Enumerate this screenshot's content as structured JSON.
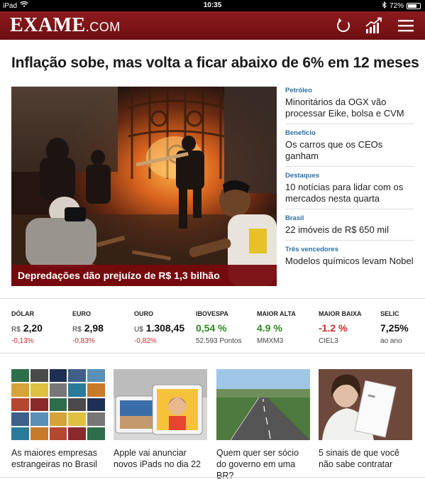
{
  "statusbar": {
    "device": "iPad",
    "time": "10:35",
    "battery": "72%",
    "battery_level": 0.72
  },
  "header": {
    "logo": "EXAME",
    "logo_suffix": ".COM",
    "refresh_icon": "refresh-icon",
    "chart_icon": "chart-icon",
    "menu_icon": "menu-icon",
    "brand_color": "#7a1216"
  },
  "headline": "Inflação sobe, mas volta a ficar abaixo de 6% em 12 meses",
  "hero": {
    "caption": "Depredações dão prejuízo de R$ 1,3 bilhão"
  },
  "side_news": [
    {
      "kicker": "Petróleo",
      "title": "Minoritários da OGX vão processar Eike, bolsa e CVM"
    },
    {
      "kicker": "Benefício",
      "title": "Os carros que os CEOs ganham"
    },
    {
      "kicker": "Destaques",
      "title": "10 notícias para lidar com os mercados nesta quarta"
    },
    {
      "kicker": "Brasil",
      "title": "22 imóveis de R$ 650 mil"
    },
    {
      "kicker": "Três vencedores",
      "title": "Modelos químicos levam Nobel"
    }
  ],
  "market": [
    {
      "label": "DÓLAR",
      "currency": "R$",
      "value": "2,20",
      "sub": "-0,13%"
    },
    {
      "label": "EURO",
      "currency": "R$",
      "value": "2,98",
      "sub": "-0,83%"
    },
    {
      "label": "OURO",
      "currency": "U$",
      "value": "1.308,45",
      "sub": "-0,82%"
    },
    {
      "label": "IBOVESPA",
      "currency": "",
      "value": "0,54 %",
      "sub": "52.593 Pontos"
    },
    {
      "label": "MAIOR ALTA",
      "currency": "",
      "value": "4.9 %",
      "sub": "MMXM3"
    },
    {
      "label": "MAIOR BAIXA",
      "currency": "",
      "value": "-1.2 %",
      "sub": "CIEL3"
    },
    {
      "label": "SELIC",
      "currency": "",
      "value": "7,25%",
      "sub": "ao ano"
    }
  ],
  "tiles": [
    {
      "caption": "As maiores empresas estrangeiras no Brasil"
    },
    {
      "caption": "Apple vai anunciar novos iPads no dia 22"
    },
    {
      "caption": "Quem quer ser sócio do governo em uma BR?"
    },
    {
      "caption": "5 sinais de que você não sabe contratar"
    }
  ]
}
